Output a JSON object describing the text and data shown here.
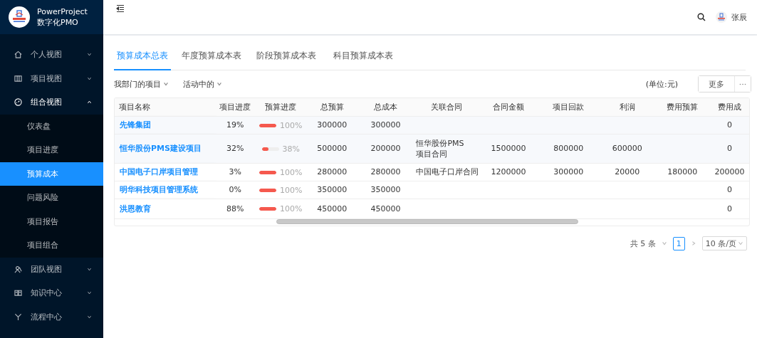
{
  "app": {
    "title": "PowerProject",
    "subtitle": "数字化PMO"
  },
  "sidebar": {
    "items": [
      {
        "label": "个人视图",
        "expanded": false
      },
      {
        "label": "项目视图",
        "expanded": false
      },
      {
        "label": "组合视图",
        "expanded": true,
        "children": [
          {
            "label": "仪表盘",
            "selected": false
          },
          {
            "label": "项目进度",
            "selected": false
          },
          {
            "label": "预算成本",
            "selected": true
          },
          {
            "label": "问题风险",
            "selected": false
          },
          {
            "label": "项目报告",
            "selected": false
          },
          {
            "label": "项目组合",
            "selected": false
          }
        ]
      },
      {
        "label": "团队视图",
        "expanded": false
      },
      {
        "label": "知识中心",
        "expanded": false
      },
      {
        "label": "流程中心",
        "expanded": false
      }
    ]
  },
  "header": {
    "user": "张辰"
  },
  "tabs": [
    {
      "label": "预算成本总表",
      "selected": true
    },
    {
      "label": "年度预算成本表",
      "selected": false
    },
    {
      "label": "阶段预算成本表",
      "selected": false
    },
    {
      "label": "科目预算成本表",
      "selected": false
    }
  ],
  "filters": [
    "我部门的项目",
    "活动中的"
  ],
  "unit": "(单位:元)",
  "more_button": "更多",
  "table": {
    "columns": [
      "项目名称",
      "项目进度",
      "预算进度",
      "总预算",
      "总成本",
      "关联合同",
      "合同金额",
      "项目回款",
      "利润",
      "费用预算",
      "费用成"
    ],
    "rows": [
      {
        "cells": [
          "先锋集团",
          "19%",
          {
            "level": 1,
            "reading": "100%"
          },
          "300000",
          "300000",
          "",
          "",
          "",
          "",
          "",
          "0"
        ]
      },
      {
        "cells": [
          "恒华股份PMS建设项目",
          "32%",
          {
            "level": 0.38,
            "reading": "38%"
          },
          "500000",
          "200000",
          "恒华股份PMS\n项目合同",
          "1500000",
          "800000",
          "600000",
          "",
          "0"
        ]
      },
      {
        "cells": [
          "中国电子口岸项目管理",
          "3%",
          {
            "level": 1,
            "reading": "100%"
          },
          "280000",
          "280000",
          "中国电子口岸合同",
          "1200000",
          "300000",
          "20000",
          "180000",
          "200000"
        ]
      },
      {
        "cells": [
          "明华科技项目管理系统",
          "0%",
          {
            "level": 1,
            "reading": "100%"
          },
          "350000",
          "350000",
          "",
          "",
          "",
          "",
          "",
          "0"
        ]
      },
      {
        "cells": [
          "洪恩教育",
          "88%",
          {
            "level": 1,
            "reading": "100%"
          },
          "450000",
          "450000",
          "",
          "",
          "",
          "",
          "",
          "0"
        ]
      }
    ]
  },
  "pagination": {
    "total": "共 5 条",
    "pages": [
      {
        "label": "1",
        "selected": true
      }
    ],
    "page_size": "10 条/页"
  }
}
